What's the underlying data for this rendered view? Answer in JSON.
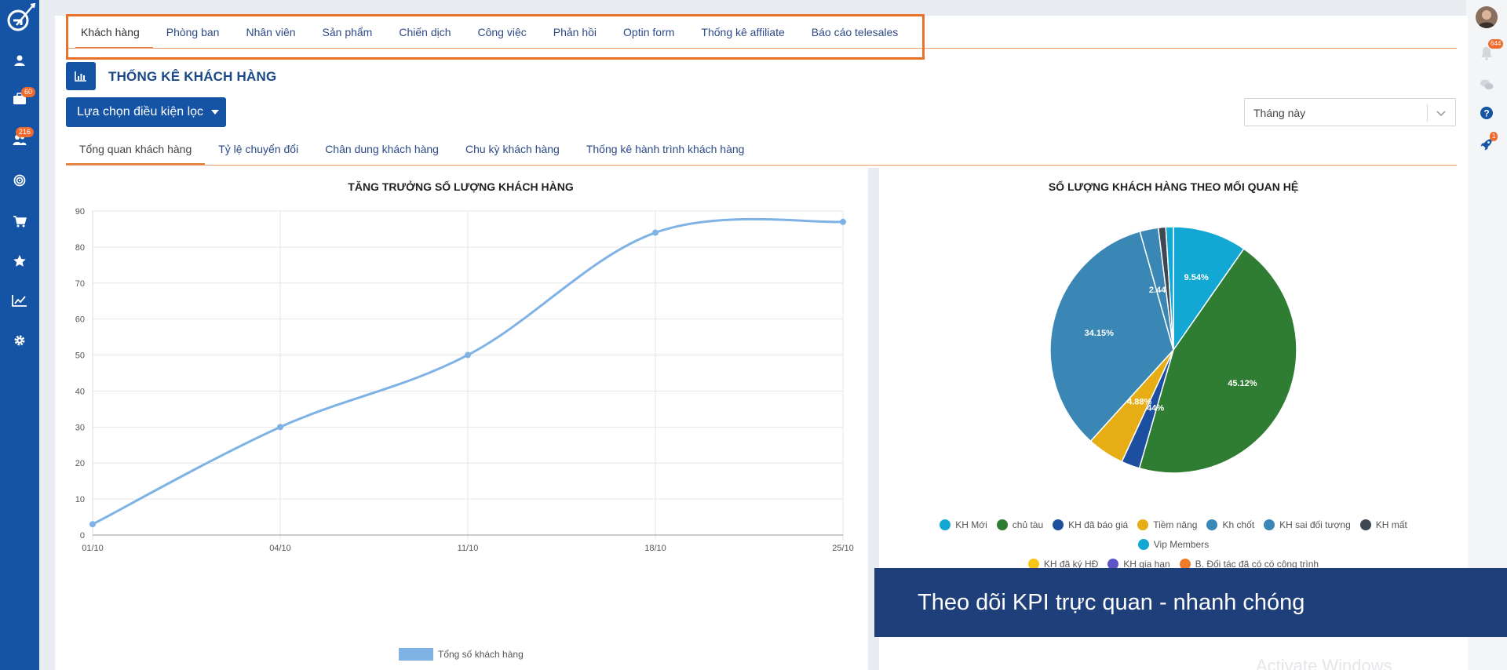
{
  "sidebar": {
    "items": [
      {
        "icon": "user-icon"
      },
      {
        "icon": "briefcase-icon",
        "badge": "60"
      },
      {
        "icon": "users-icon",
        "badge": "216"
      },
      {
        "icon": "target-icon"
      },
      {
        "icon": "cart-icon"
      },
      {
        "icon": "star-icon"
      },
      {
        "icon": "trend-chart-icon"
      },
      {
        "icon": "gear-icon"
      }
    ]
  },
  "rightbar": {
    "notifications_badge": "644",
    "rocket_badge": "1"
  },
  "topnav": {
    "tabs": [
      "Khách hàng",
      "Phòng ban",
      "Nhân viên",
      "Sản phẩm",
      "Chiến dịch",
      "Công việc",
      "Phản hồi",
      "Optin form",
      "Thống kê affiliate",
      "Báo cáo telesales"
    ],
    "active_index": 0
  },
  "page": {
    "title": "THỐNG KÊ KHÁCH HÀNG",
    "filter_button": "Lựa chọn điều kiện lọc",
    "period_value": "Tháng này"
  },
  "subtabs": {
    "tabs": [
      "Tổng quan khách hàng",
      "Tỷ lệ chuyển đổi",
      "Chân dung khách hàng",
      "Chu kỳ khách hàng",
      "Thống kê hành trình khách hàng"
    ],
    "active_index": 0
  },
  "chart_data": [
    {
      "type": "line",
      "title": "TĂNG TRƯỞNG SỐ LƯỢNG KHÁCH HÀNG",
      "x": [
        "01/10",
        "04/10",
        "11/10",
        "18/10",
        "25/10"
      ],
      "series": [
        {
          "name": "Tổng số khách hàng",
          "values": [
            3,
            30,
            50,
            84,
            87
          ],
          "color": "#7fb2e5"
        }
      ],
      "ylim": [
        0,
        90
      ],
      "yticks": [
        0,
        10,
        20,
        30,
        40,
        50,
        60,
        70,
        80,
        90
      ],
      "grid": true,
      "legend": "bottom"
    },
    {
      "type": "pie",
      "title": "SỐ LƯỢNG KHÁCH HÀNG THEO MỐI QUAN HỆ",
      "slices": [
        {
          "name": "KH Mới",
          "value": 9.76,
          "color": "#13a7d4",
          "label": "9.54%"
        },
        {
          "name": "chủ tàu",
          "value": 45.12,
          "color": "#2e7d32",
          "label": "45.12%"
        },
        {
          "name": "KH đã báo giá",
          "value": 2.44,
          "color": "#1d4fa0",
          "label": "2.44%"
        },
        {
          "name": "Tiềm năng",
          "value": 4.88,
          "color": "#e6ad15",
          "label": "4.88%"
        },
        {
          "name": "Kh chốt",
          "value": 34.15,
          "color": "#3a86b4",
          "label": "34.15%"
        },
        {
          "name": "KH sai đối tượng",
          "value": 2.44,
          "color": "#3a86b4",
          "label": "2.44%"
        },
        {
          "name": "KH mất",
          "value": 0.98,
          "color": "#3d4852",
          "label": ""
        },
        {
          "name": "Vip Members",
          "value": 1.0,
          "color": "#13a7d4",
          "label": ""
        }
      ],
      "legend": [
        {
          "name": "KH Mới",
          "color": "#13a7d4"
        },
        {
          "name": "chủ tàu",
          "color": "#2e7d32"
        },
        {
          "name": "KH đã báo giá",
          "color": "#1d4fa0"
        },
        {
          "name": "Tiềm năng",
          "color": "#e6ad15"
        },
        {
          "name": "Kh chốt",
          "color": "#3a86b4"
        },
        {
          "name": "KH sai đối tượng",
          "color": "#3a86b4"
        },
        {
          "name": "KH mất",
          "color": "#3d4852"
        },
        {
          "name": "Vip Members",
          "color": "#13a7d4"
        },
        {
          "name": "KH đã ký HĐ",
          "color": "#f5c518"
        },
        {
          "name": "KH gia hạn",
          "color": "#5b55c7"
        },
        {
          "name": "B. Đối tác đã có có công trình",
          "color": "#ef7a2a"
        }
      ]
    }
  ],
  "banner": {
    "text": "Theo dõi KPI trực quan - nhanh chóng"
  },
  "watermark": {
    "text": "Activate Windows"
  }
}
